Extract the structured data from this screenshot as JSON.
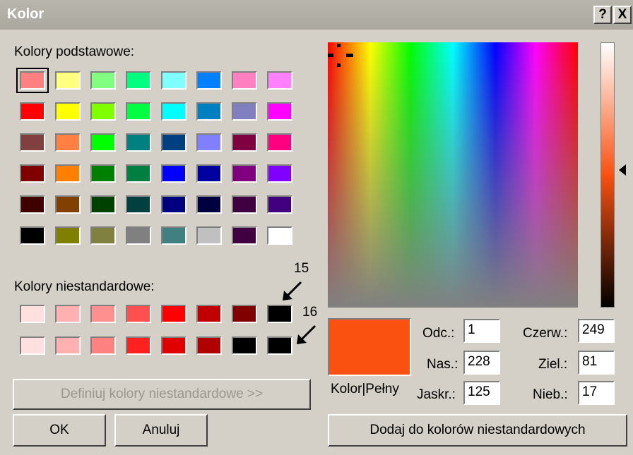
{
  "window": {
    "title": "Kolor",
    "help_label": "?",
    "close_label": "X"
  },
  "basic_colors": {
    "label": "Kolory podstawowe:",
    "rows": [
      [
        "#ff8080",
        "#ffff80",
        "#80ff80",
        "#00ff80",
        "#80ffff",
        "#0080ff",
        "#ff80c0",
        "#ff80ff"
      ],
      [
        "#ff0000",
        "#ffff00",
        "#80ff00",
        "#00ff40",
        "#00ffff",
        "#0080c0",
        "#8080c0",
        "#ff00ff"
      ],
      [
        "#804040",
        "#ff8040",
        "#00ff00",
        "#008080",
        "#004080",
        "#8080ff",
        "#800040",
        "#ff0080"
      ],
      [
        "#800000",
        "#ff8000",
        "#008000",
        "#008040",
        "#0000ff",
        "#0000a0",
        "#800080",
        "#8000ff"
      ],
      [
        "#400000",
        "#804000",
        "#004000",
        "#004040",
        "#000080",
        "#000040",
        "#400040",
        "#400080"
      ],
      [
        "#000000",
        "#808000",
        "#808040",
        "#808080",
        "#408080",
        "#c0c0c0",
        "#400040",
        "#ffffff"
      ]
    ]
  },
  "custom_colors": {
    "label": "Kolory niestandardowe:",
    "rows": [
      [
        "#ffe0e0",
        "#ffb0b0",
        "#ff9090",
        "#ff5050",
        "#ff0000",
        "#c00000",
        "#800000",
        "#000000"
      ],
      [
        "#ffe0e0",
        "#ffb0b0",
        "#ff8080",
        "#ff2020",
        "#e00000",
        "#b00000",
        "#000000",
        "#000000"
      ]
    ],
    "marker_15": "15",
    "marker_16": "16"
  },
  "buttons": {
    "define_custom": "Definiuj kolory niestandardowe >>",
    "ok": "OK",
    "cancel": "Anuluj",
    "add_custom": "Dodaj do kolorów niestandardowych"
  },
  "preview": {
    "label": "Kolor|Pełny",
    "color": "#fa5111"
  },
  "fields": {
    "hue_label": "Odc.:",
    "hue": "1",
    "sat_label": "Nas.:",
    "sat": "228",
    "lum_label": "Jaskr.:",
    "lum": "125",
    "red_label": "Czerw.:",
    "red": "249",
    "green_label": "Ziel.:",
    "green": "81",
    "blue_label": "Nieb.:",
    "blue": "17"
  }
}
